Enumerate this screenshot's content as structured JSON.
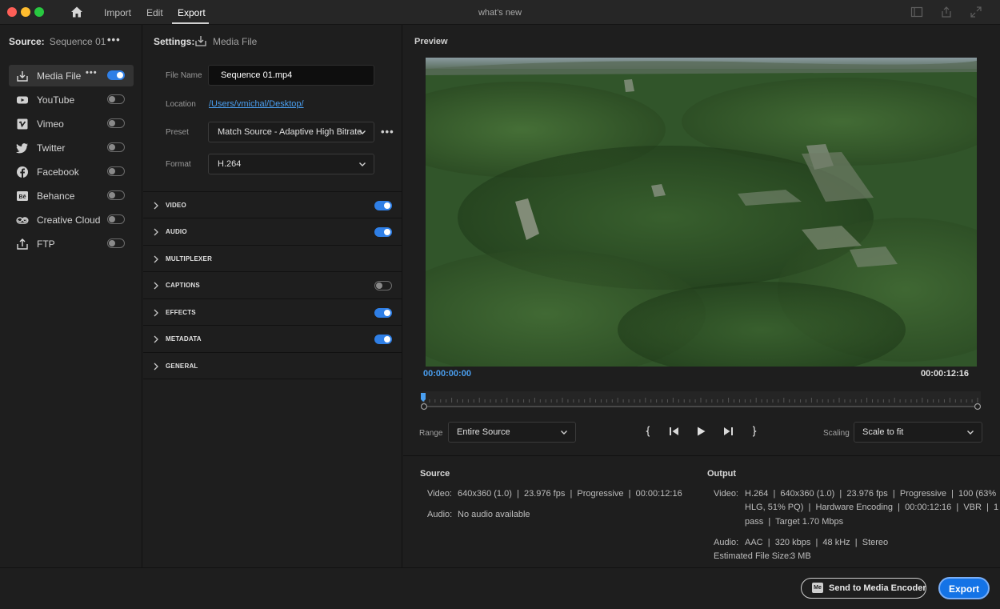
{
  "titlebar": {
    "nav": {
      "import": "Import",
      "edit": "Edit",
      "export": "Export"
    },
    "window_title": "what's new"
  },
  "source": {
    "label": "Source:",
    "name": "Sequence 01"
  },
  "destinations": [
    {
      "label": "Media File",
      "icon": "download-icon",
      "enabled": true,
      "selected": true
    },
    {
      "label": "YouTube",
      "icon": "youtube-icon",
      "enabled": false
    },
    {
      "label": "Vimeo",
      "icon": "vimeo-icon",
      "enabled": false
    },
    {
      "label": "Twitter",
      "icon": "twitter-icon",
      "enabled": false
    },
    {
      "label": "Facebook",
      "icon": "facebook-icon",
      "enabled": false
    },
    {
      "label": "Behance",
      "icon": "behance-icon",
      "enabled": false
    },
    {
      "label": "Creative Cloud",
      "icon": "creative-cloud-icon",
      "enabled": false
    },
    {
      "label": "FTP",
      "icon": "upload-icon",
      "enabled": false
    }
  ],
  "settings": {
    "label": "Settings:",
    "target": "Media File",
    "file_name_label": "File Name",
    "file_name": "Sequence 01.mp4",
    "location_label": "Location",
    "location": "/Users/vmichal/Desktop/",
    "preset_label": "Preset",
    "preset": "Match Source - Adaptive High Bitrate",
    "format_label": "Format",
    "format": "H.264",
    "sections": [
      {
        "label": "VIDEO",
        "toggle": "on"
      },
      {
        "label": "AUDIO",
        "toggle": "on"
      },
      {
        "label": "MULTIPLEXER",
        "toggle": "none"
      },
      {
        "label": "CAPTIONS",
        "toggle": "off"
      },
      {
        "label": "EFFECTS",
        "toggle": "on"
      },
      {
        "label": "METADATA",
        "toggle": "on"
      },
      {
        "label": "GENERAL",
        "toggle": "none"
      }
    ]
  },
  "preview": {
    "title": "Preview",
    "timecode_start": "00:00:00:00",
    "timecode_end": "00:00:12:16",
    "range_label": "Range",
    "range_value": "Entire Source",
    "scaling_label": "Scaling",
    "scaling_value": "Scale to fit"
  },
  "info": {
    "source_heading": "Source",
    "source_video_key": "Video:",
    "source_video": "640x360 (1.0)  |  23.976 fps  |  Progressive  |  00:00:12:16",
    "source_audio_key": "Audio:",
    "source_audio": "No audio available",
    "output_heading": "Output",
    "output_video_key": "Video:",
    "output_video_l1": "H.264  |  640x360 (1.0)  |  23.976 fps  |  Progressive  |  100 (63%",
    "output_video_l2": "HLG, 51% PQ)  |  Hardware Encoding  |  00:00:12:16  |  VBR  |  1",
    "output_video_l3": "pass  |  Target 1.70 Mbps",
    "output_audio_key": "Audio:",
    "output_audio": "AAC  |  320 kbps  |  48 kHz  |  Stereo",
    "file_size_key": "Estimated File Size:",
    "file_size": "3 MB"
  },
  "footer": {
    "send_label": "Send to Media Encoder",
    "me_badge": "Me",
    "export_label": "Export"
  },
  "colors": {
    "accent": "#1473e6",
    "toggle_on": "#2f7fe6",
    "link": "#4a9ff0",
    "timecode": "#4a9ff0"
  }
}
